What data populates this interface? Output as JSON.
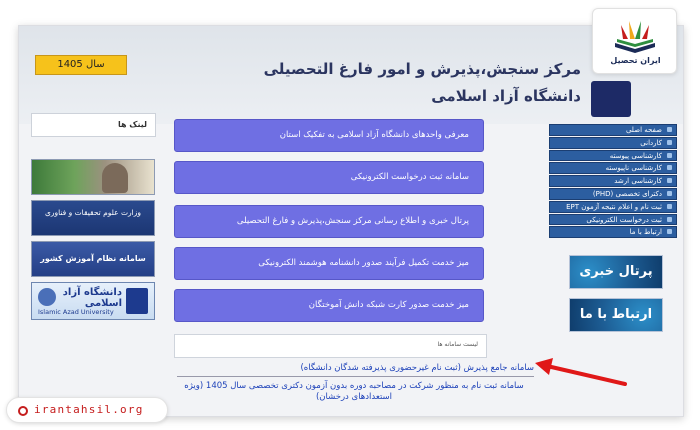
{
  "header": {
    "title_line1": "مرکز سنجش،پذیرش و امور فارغ التحصیلی",
    "title_line2": "دانشگاه آزاد اسلامی",
    "year_label": "سال 1405"
  },
  "right_nav": {
    "items": [
      "صفحه اصلی",
      "کاردانی",
      "کارشناسی پیوسته",
      "کارشناسی ناپیوسته",
      "کارشناسی ارشد",
      "دکترای تخصصی (PHD)",
      "ثبت نام و اعلام نتیجه آزمون EPT",
      "ثبت درخواست الکترونیکی",
      "ارتباط با ما"
    ],
    "banners": {
      "news": "پرتال خبری",
      "contact": "ارتباط با ما"
    }
  },
  "main": {
    "services": [
      "معرفی واحدهای دانشگاه آزاد اسلامی به تفکیک استان",
      "سامانه ثبت درخواست الکترونیکی",
      "پرتال خبری و اطلاع رسانی مرکز سنجش،پذیرش و فارغ التحصیلی",
      "میز خدمت تکمیل فرآیند صدور دانشنامه هوشمند الکترونیکی",
      "میز خدمت صدور کارت شبکه دانش آموختگان"
    ],
    "list_title": "لیست سامانه ها",
    "links": [
      "سامانه جامع پذیرش (ثبت نام غیرحضوری پذیرفته شدگان دانشگاه)",
      "سامانه ثبت نام به منظور شرکت در مصاحبه دوره بدون آزمون دکتری تخصصی سال 1405 (ویژه استعدادهای درخشان)"
    ]
  },
  "sidebar_left": {
    "links_title": "لینک ها",
    "thumbs": {
      "ministry": "وزارت علوم تحقیقات و فناوری",
      "open_edu": "سامانه نظام آموزش کشور",
      "azad_fa": "دانشگاه آزاد اسلامی",
      "azad_en": "Islamic Azad University"
    }
  },
  "watermark": {
    "logo_text": "ایران تحصیل",
    "site": "irantahsil.org"
  },
  "colors": {
    "service_button": "#6f6fe3",
    "nav_item": "#2c5ea0",
    "year_box": "#f6c21b",
    "arrow": "#e01818",
    "link": "#1a3fb8"
  }
}
